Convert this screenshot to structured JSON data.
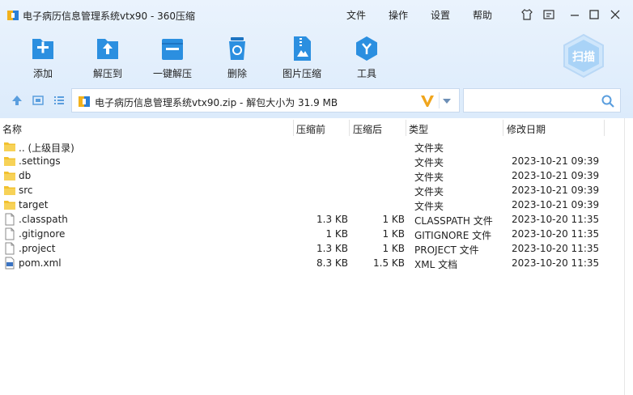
{
  "window": {
    "title": "电子病历信息管理系统vtx90 - 360压缩",
    "menu": [
      "文件",
      "操作",
      "设置",
      "帮助"
    ]
  },
  "toolbar": {
    "items": [
      {
        "label": "添加",
        "icon": "add-icon"
      },
      {
        "label": "解压到",
        "icon": "extract-to-icon"
      },
      {
        "label": "一键解压",
        "icon": "one-click-extract-icon"
      },
      {
        "label": "删除",
        "icon": "delete-icon"
      },
      {
        "label": "图片压缩",
        "icon": "image-compress-icon"
      },
      {
        "label": "工具",
        "icon": "tools-icon"
      }
    ],
    "scan_label": "扫描"
  },
  "address": {
    "path": "电子病历信息管理系统vtx90.zip - 解包大小为 31.9 MB"
  },
  "search": {
    "value": ""
  },
  "list": {
    "columns": [
      "名称",
      "压缩前",
      "压缩后",
      "类型",
      "修改日期"
    ],
    "rows": [
      {
        "name": ".. (上级目录)",
        "size": "",
        "packed": "",
        "type": "文件夹",
        "date": "",
        "icon": "folder-icon"
      },
      {
        "name": ".settings",
        "size": "",
        "packed": "",
        "type": "文件夹",
        "date": "2023-10-21 09:39",
        "icon": "folder-icon"
      },
      {
        "name": "db",
        "size": "",
        "packed": "",
        "type": "文件夹",
        "date": "2023-10-21 09:39",
        "icon": "folder-icon"
      },
      {
        "name": "src",
        "size": "",
        "packed": "",
        "type": "文件夹",
        "date": "2023-10-21 09:39",
        "icon": "folder-icon"
      },
      {
        "name": "target",
        "size": "",
        "packed": "",
        "type": "文件夹",
        "date": "2023-10-21 09:39",
        "icon": "folder-icon"
      },
      {
        "name": ".classpath",
        "size": "1.3 KB",
        "packed": "1 KB",
        "type": "CLASSPATH 文件",
        "date": "2023-10-20 11:35",
        "icon": "file-icon"
      },
      {
        "name": ".gitignore",
        "size": "1 KB",
        "packed": "1 KB",
        "type": "GITIGNORE 文件",
        "date": "2023-10-20 11:35",
        "icon": "file-icon"
      },
      {
        "name": ".project",
        "size": "1.3 KB",
        "packed": "1 KB",
        "type": "PROJECT 文件",
        "date": "2023-10-20 11:35",
        "icon": "file-icon"
      },
      {
        "name": "pom.xml",
        "size": "8.3 KB",
        "packed": "1.5 KB",
        "type": "XML 文档",
        "date": "2023-10-20 11:35",
        "icon": "xml-file-icon"
      }
    ]
  },
  "colors": {
    "accent": "#2b8fe0",
    "toolbar_bg": "#e3effc",
    "folder": "#f2c12e"
  }
}
